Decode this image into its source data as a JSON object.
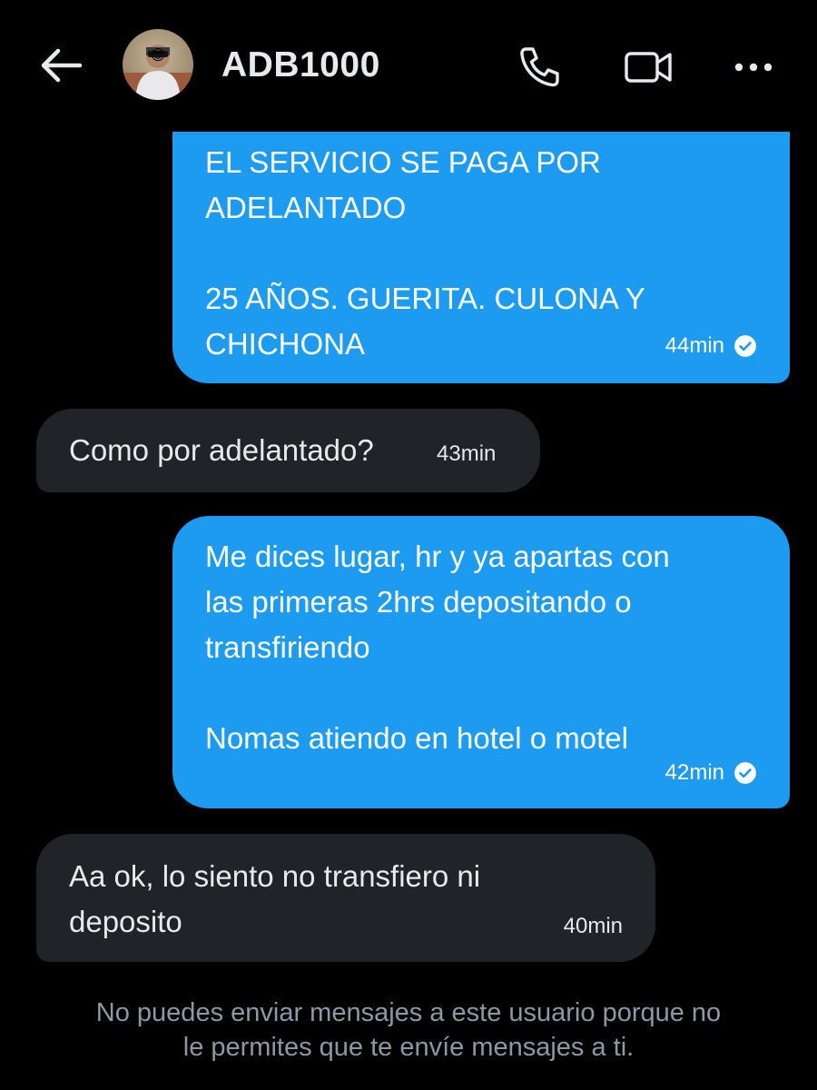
{
  "header": {
    "name": "ADB1000",
    "back_icon": "arrow-left-icon",
    "call_icon": "phone-icon",
    "video_icon": "video-camera-icon",
    "more_icon": "more-horizontal-icon"
  },
  "colors": {
    "background": "#000000",
    "outgoing_bubble": "#1d9bf0",
    "incoming_bubble": "#202327",
    "notice_text": "#8b98a5"
  },
  "messages": [
    {
      "direction": "outgoing",
      "text": "EL SERVICIO SE PAGA POR\nADELANTADO\n\n25 AÑOS. GUERITA. CULONA Y\nCHICHONA",
      "time": "44min",
      "status_icon": "check-circle-icon"
    },
    {
      "direction": "incoming",
      "text": "Como por adelantado?",
      "time": "43min"
    },
    {
      "direction": "outgoing",
      "text": "Me dices lugar, hr y ya apartas con\nlas primeras 2hrs depositando o\ntransfiriendo\n\nNomas atiendo en hotel o motel",
      "time": "42min",
      "status_icon": "check-circle-icon"
    },
    {
      "direction": "incoming",
      "text": "Aa ok, lo siento no transfiero ni\ndeposito",
      "time": "40min"
    }
  ],
  "notice": "No puedes enviar mensajes a este usuario porque no\nle permites que te envíe mensajes a ti."
}
